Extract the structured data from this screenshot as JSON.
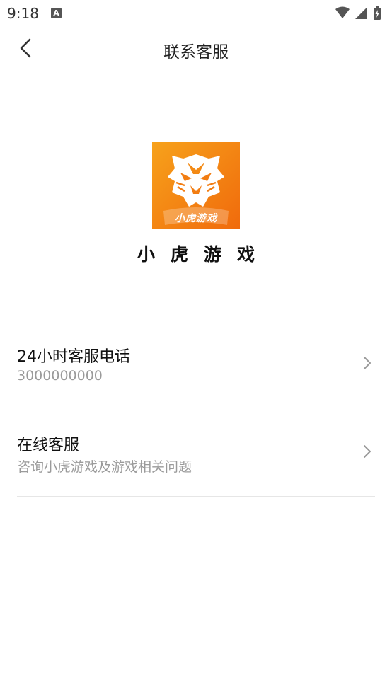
{
  "status_bar": {
    "time": "9:18",
    "notification_icon": "A"
  },
  "header": {
    "title": "联系客服",
    "back_icon": "chevron-left-icon"
  },
  "app": {
    "logo_text": "小虎游戏",
    "name": "小虎游戏",
    "brand_colors": [
      "#f7a21b",
      "#f06a0c"
    ]
  },
  "contact_items": [
    {
      "title": "24小时客服电话",
      "subtitle": "3000000000"
    },
    {
      "title": "在线客服",
      "subtitle": "咨询小虎游戏及游戏相关问题"
    }
  ]
}
